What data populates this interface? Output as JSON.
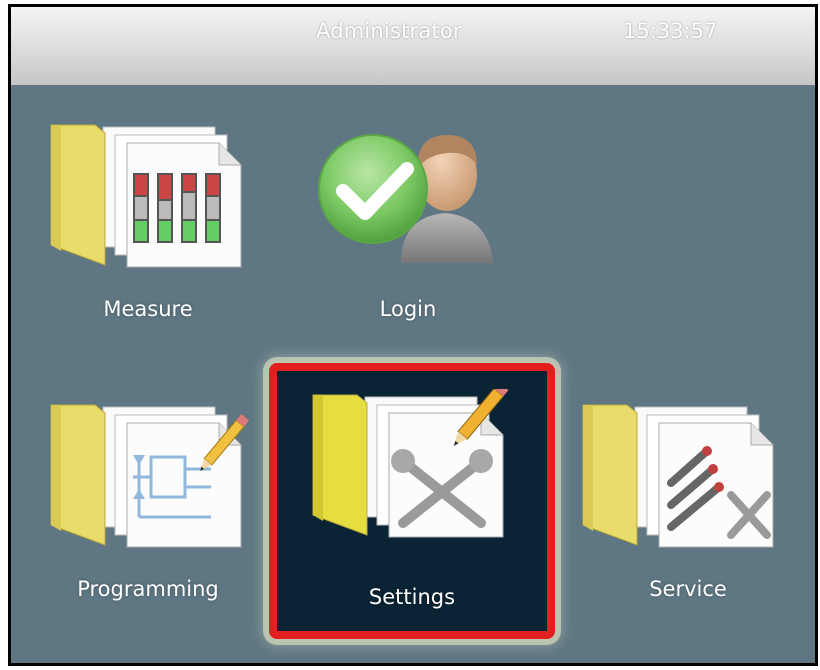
{
  "header": {
    "user": "Administrator",
    "time": "15:33:57"
  },
  "tiles": {
    "measure": {
      "label": "Measure",
      "icon": "measure-folder-icon"
    },
    "login": {
      "label": "Login",
      "icon": "login-user-check-icon"
    },
    "programming": {
      "label": "Programming",
      "icon": "programming-folder-icon"
    },
    "settings": {
      "label": "Settings",
      "icon": "settings-folder-tools-icon",
      "selected": true
    },
    "service": {
      "label": "Service",
      "icon": "service-folder-tools-icon"
    }
  },
  "colors": {
    "background": "#5f7783",
    "selected_fill": "#0a2435",
    "selected_border": "#e22020",
    "folder": "#e9dc6a"
  }
}
